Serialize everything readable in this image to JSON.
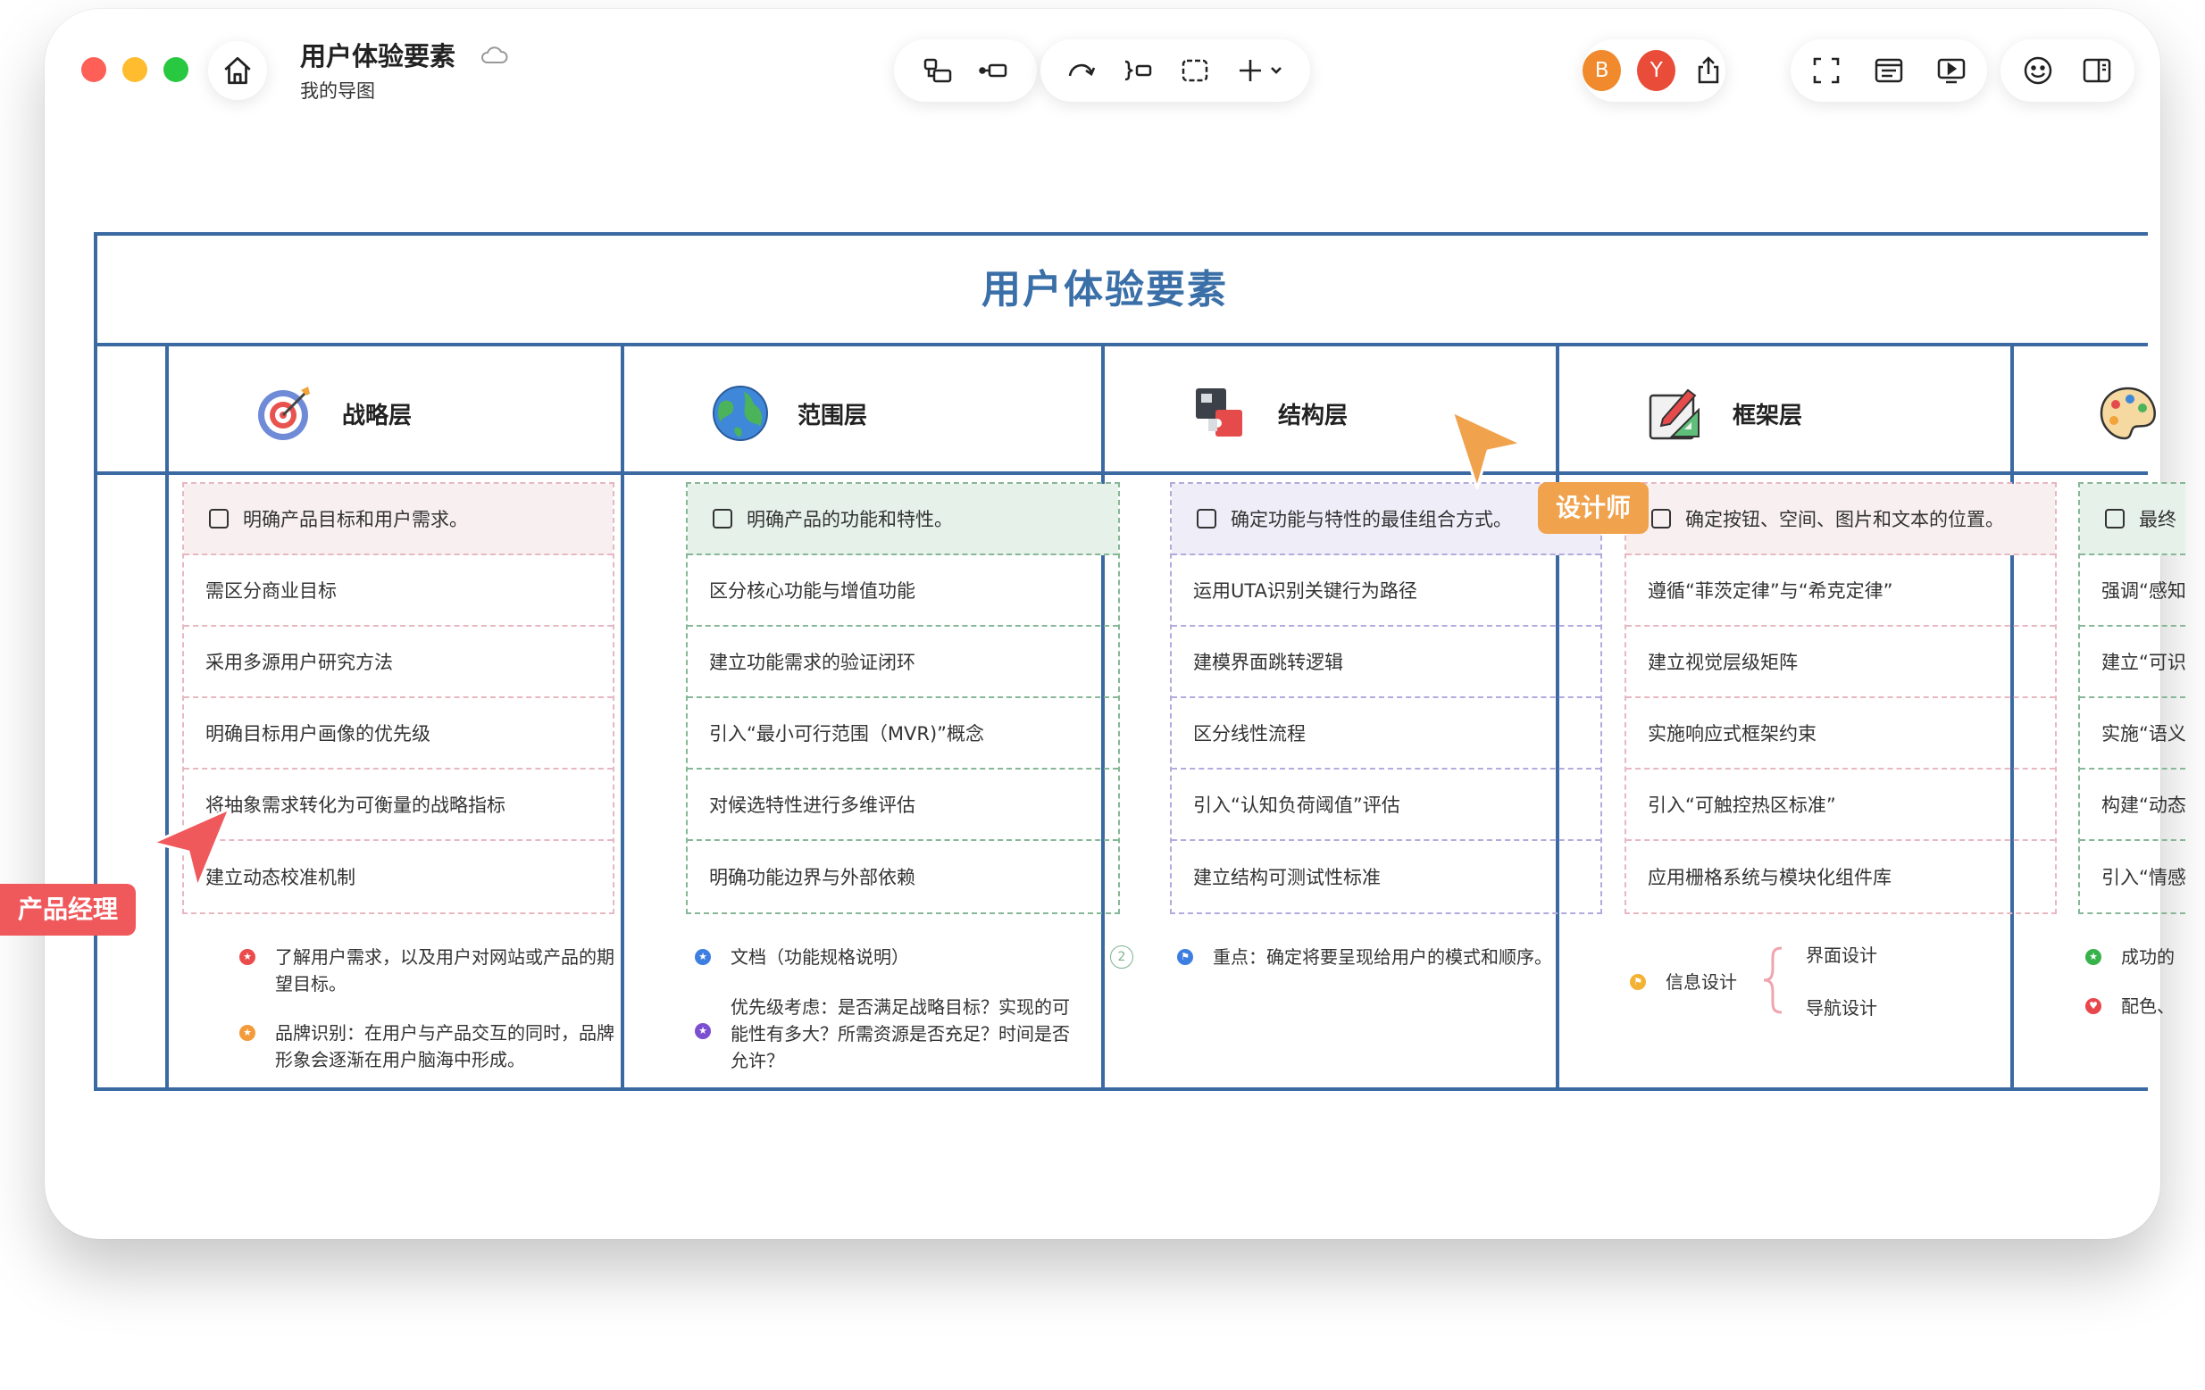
{
  "window": {
    "title": "用户体验要素",
    "subtitle": "我的导图"
  },
  "toolbar": {
    "left_tools": [
      "insert-subtopic-icon",
      "insert-sibling-icon"
    ],
    "mid_tools": [
      "relationship-icon",
      "summary-icon",
      "boundary-icon",
      "add-icon"
    ],
    "collaborators": [
      {
        "initial": "B",
        "color": "#f08a2c"
      },
      {
        "initial": "Y",
        "color": "#ea4c3a"
      }
    ],
    "right_tools": [
      "share-icon",
      "fullscreen-icon",
      "outline-icon",
      "present-icon",
      "emoji-icon",
      "panel-icon"
    ]
  },
  "board": {
    "title": "用户体验要素",
    "columns": [
      {
        "label": "战略层",
        "icon": "target-icon",
        "tint": "#f8eff1",
        "border": "#e7b8c2",
        "items": [
          "明确产品目标和用户需求。",
          "需区分商业目标",
          "采用多源用户研究方法",
          "明确目标用户画像的优先级",
          "将抽象需求转化为可衡量的战略指标",
          "建立动态校准机制"
        ],
        "notes": [
          {
            "text": "了解用户需求，以及用户对网站或产品的期望目标。",
            "color": "#ea4c4c"
          },
          {
            "text": "品牌识别：在用户与产品交互的同时，品牌形象会逐渐在用户脑海中形成。",
            "color": "#f39b3b"
          }
        ]
      },
      {
        "label": "范围层",
        "icon": "globe-icon",
        "tint": "#e6f1ea",
        "border": "#86b796",
        "items": [
          "明确产品的功能和特性。",
          "区分核心功能与增值功能",
          "建立功能需求的验证闭环",
          "引入“最小可行范围（MVR)”概念",
          "对候选特性进行多维评估",
          "明确功能边界与外部依赖"
        ],
        "notes": [
          {
            "text": "文档（功能规格说明）",
            "color": "#3d7ee0",
            "badge": "2"
          },
          {
            "text": "优先级考虑：是否满足战略目标？实现的可能性有多大？所需资源是否充足？时间是否允许？",
            "color": "#7b4fd0"
          }
        ]
      },
      {
        "label": "结构层",
        "icon": "puzzle-icon",
        "tint": "#efedf8",
        "border": "#b4aade",
        "items": [
          "确定功能与特性的最佳组合方式。",
          "运用UTA识别关键行为路径",
          "建模界面跳转逻辑",
          "区分线性流程",
          "引入“认知负荷阈值”评估",
          "建立结构可测试性标准"
        ],
        "notes": [
          {
            "text": "重点：确定将要呈现给用户的模式和顺序。",
            "color": "#3d7ee0"
          }
        ]
      },
      {
        "label": "框架层",
        "icon": "design-icon",
        "tint": "#f8eff1",
        "border": "#e7b8c2",
        "items": [
          "确定按钮、空间、图片和文本的位置。",
          "遵循“菲茨定律”与“希克定律”",
          "建立视觉层级矩阵",
          "实施响应式框架约束",
          "引入“可触控热区标准”",
          "应用栅格系统与模块化组件库"
        ],
        "notes": [
          {
            "text": "信息设计",
            "color": "#f3b234"
          }
        ],
        "summary": [
          "界面设计",
          "导航设计"
        ]
      },
      {
        "label": "",
        "icon": "palette-icon",
        "tint": "#e6f1ea",
        "border": "#86b796",
        "items": [
          "最终",
          "强调“感知",
          "建立“可识",
          "实施“语义",
          "构建“动态",
          "引入“情感"
        ],
        "notes": [
          {
            "text": "成功的",
            "color": "#38b24a"
          },
          {
            "text": "配色、",
            "color": "#e8474b"
          }
        ]
      }
    ]
  },
  "cursors": [
    {
      "name": "设计师",
      "color": "#f0a24c"
    },
    {
      "name": "产品经理",
      "color": "#f0595c"
    }
  ]
}
